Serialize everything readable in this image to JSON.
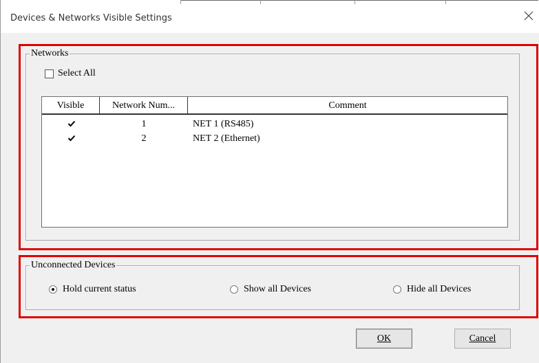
{
  "window": {
    "title": "Devices & Networks Visible Settings",
    "close_glyph": "×"
  },
  "networks": {
    "group_label": "Networks",
    "select_all_label": "Select All",
    "select_all_checked": false,
    "columns": [
      "Visible",
      "Network Num...",
      "Comment"
    ],
    "rows": [
      {
        "visible": true,
        "number": "1",
        "comment": "NET 1 (RS485)"
      },
      {
        "visible": true,
        "number": "2",
        "comment": "NET 2 (Ethernet)"
      }
    ]
  },
  "unconnected": {
    "group_label": "Unconnected Devices",
    "options": [
      {
        "label": "Hold current status",
        "selected": true
      },
      {
        "label": "Show all Devices",
        "selected": false
      },
      {
        "label": "Hide all Devices",
        "selected": false
      }
    ]
  },
  "buttons": {
    "ok_label": "OK",
    "cancel_label": "Cancel"
  },
  "colors": {
    "highlight_box": "#e00000",
    "window_bg": "#f0f0f0"
  }
}
